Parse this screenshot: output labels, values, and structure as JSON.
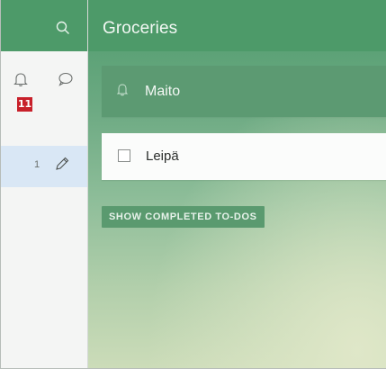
{
  "list": {
    "title": "Groceries",
    "new_todo_text": "Maito",
    "badge": "11"
  },
  "todos": [
    {
      "label": "Leipä",
      "completed": false
    }
  ],
  "sidebar": {
    "selected_count": "1",
    "icons": [
      "search-icon",
      "bell-icon",
      "comment-icon",
      "pencil-icon"
    ]
  },
  "actions": {
    "show_completed": "SHOW COMPLETED TO-DOS"
  },
  "colors": {
    "accent": "#4d9a69",
    "selected_row": "#d9e7f5",
    "badge": "#c8202a"
  }
}
